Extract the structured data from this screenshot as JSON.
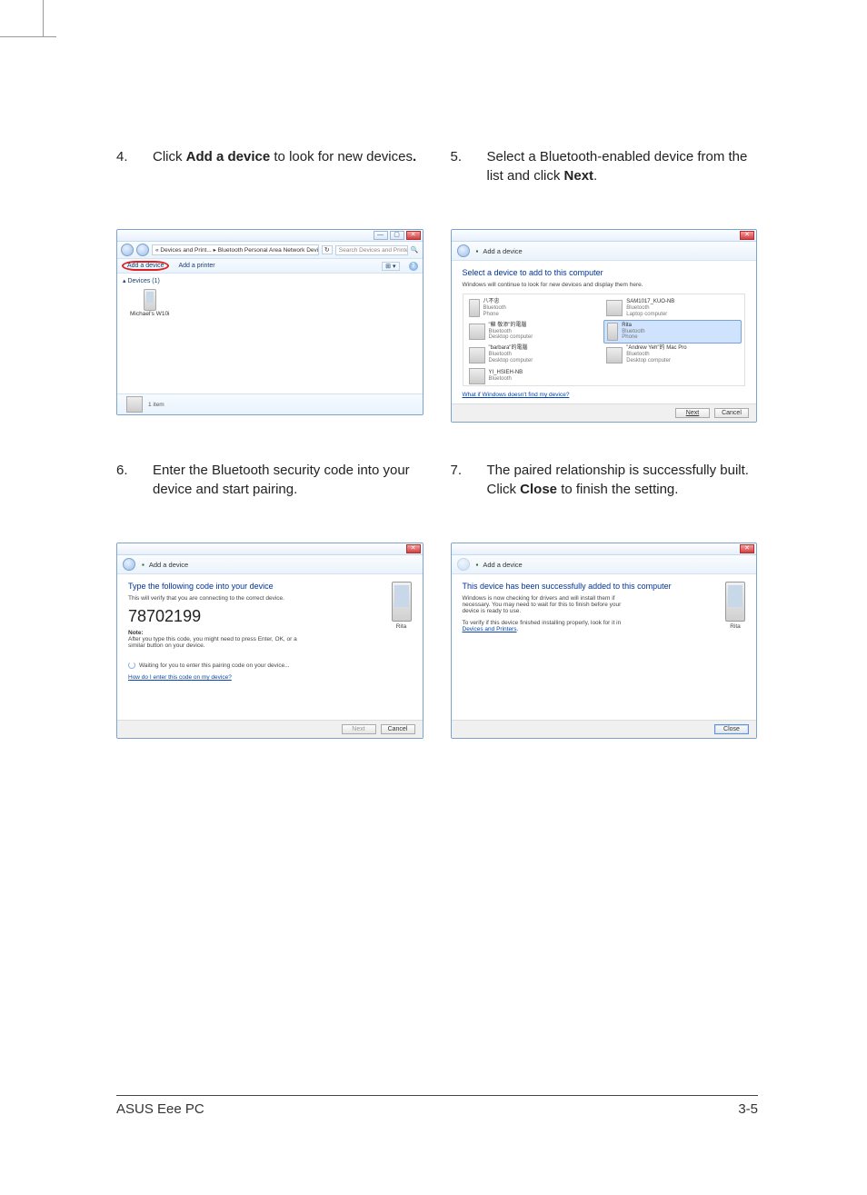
{
  "steps": {
    "s4": {
      "num": "4.",
      "pre": "Click ",
      "bold": "Add a device",
      "post": " to look for new devices",
      "bold2": "."
    },
    "s5": {
      "num": "5.",
      "pre": "Select a Bluetooth-enabled device from the list and click ",
      "bold": "Next",
      "post": "."
    },
    "s6": {
      "num": "6.",
      "text": "Enter the Bluetooth security code into your device and start pairing."
    },
    "s7": {
      "num": "7.",
      "pre": "The paired relationship is successfully built. Click ",
      "bold": "Close",
      "post": " to finish the setting."
    }
  },
  "shot4": {
    "breadcrumb": "« Devices and Print... ▸ Bluetooth Personal Area Network Devices",
    "refresh": "↻",
    "search_placeholder": "Search Devices and Printers",
    "toolbar_add_device": "Add a device",
    "toolbar_add_printer": "Add a printer",
    "group_header": "▴ Devices (1)",
    "device_name": "Michael's W10i",
    "statusbar_text": "1 item"
  },
  "shot5": {
    "window_title": "Add a device",
    "title": "Select a device to add to this computer",
    "subtitle": "Windows will continue to look for new devices and display them here.",
    "devices": [
      {
        "name": "八不忠",
        "l2": "Bluetooth",
        "l3": "Phone",
        "tall": true
      },
      {
        "name": "SAM1017_KUO-NB",
        "l2": "Bluetooth",
        "l3": "Laptop computer"
      },
      {
        "name": "\"蘇 敬添\"的電腦",
        "l2": "Bluetooth",
        "l3": "Desktop computer"
      },
      {
        "name": "Rita",
        "l2": "Bluetooth",
        "l3": "Phone",
        "selected": true,
        "tall": true
      },
      {
        "name": "\"barbara\"的電腦",
        "l2": "Bluetooth",
        "l3": "Desktop computer"
      },
      {
        "name": "\"Andrew Yeh\"的 Mac Pro",
        "l2": "Bluetooth",
        "l3": "Desktop computer"
      },
      {
        "name": "YI_HSIEH-NB",
        "l2": "Bluetooth",
        "l3": ""
      }
    ],
    "link": "What if Windows doesn't find my device?",
    "btn_next": "Next",
    "btn_cancel": "Cancel"
  },
  "shot6": {
    "window_title": "Add a device",
    "title": "Type the following code into your device",
    "subtitle": "This will verify that you are connecting to the correct device.",
    "code": "78702199",
    "note_label": "Note:",
    "note_text": "After you type this code, you might need to press Enter, OK, or a similar button on your device.",
    "waiting": "Waiting for you to enter this pairing code on your device...",
    "link": "How do I enter this code on my device?",
    "phone_label": "Rita",
    "btn_next": "Next",
    "btn_cancel": "Cancel"
  },
  "shot7": {
    "window_title": "Add a device",
    "title": "This device has been successfully added to this computer",
    "line1": "Windows is now checking for drivers and will install them if necessary. You may need to wait for this to finish before your device is ready to use.",
    "line2_pre": "To verify if this device finished installing properly, look for it in ",
    "line2_link": "Devices and Printers",
    "phone_label": "Rita",
    "btn_close": "Close"
  },
  "footer": {
    "left": "ASUS Eee PC",
    "right": "3-5"
  }
}
